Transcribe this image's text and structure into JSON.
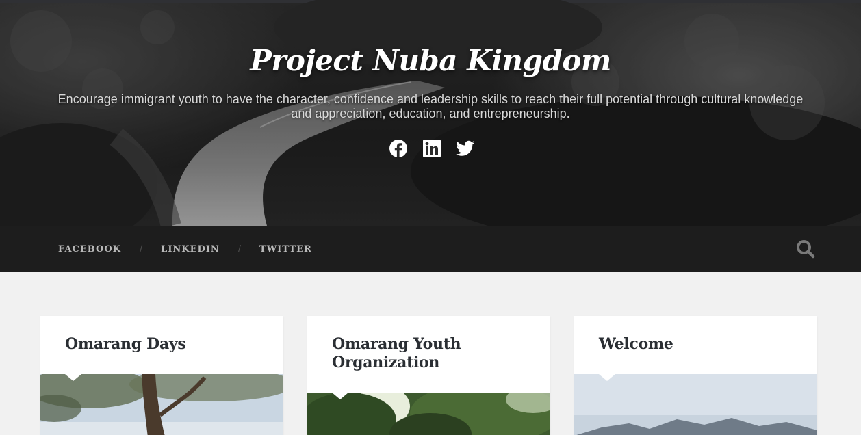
{
  "site": {
    "title": "Project Nuba Kingdom",
    "tagline": "Encourage immigrant youth to have the character, confidence and leadership skills to reach their full potential through cultural knowledge and appreciation, education, and entrepreneurship."
  },
  "social_icons": [
    "facebook-icon",
    "linkedin-icon",
    "twitter-icon"
  ],
  "nav": {
    "items": [
      {
        "label": "FACEBOOK"
      },
      {
        "label": "LINKEDIN"
      },
      {
        "label": "TWITTER"
      }
    ],
    "separator": "/",
    "search_icon": "search-icon"
  },
  "posts": [
    {
      "title": "Omarang Days"
    },
    {
      "title": "Omarang Youth Organization"
    },
    {
      "title": "Welcome"
    }
  ],
  "colors": {
    "nav_bg": "#1d1d1d",
    "page_bg": "#f1f1f1",
    "title_text": "#2a2e33",
    "nav_text": "#b9b9b9"
  }
}
